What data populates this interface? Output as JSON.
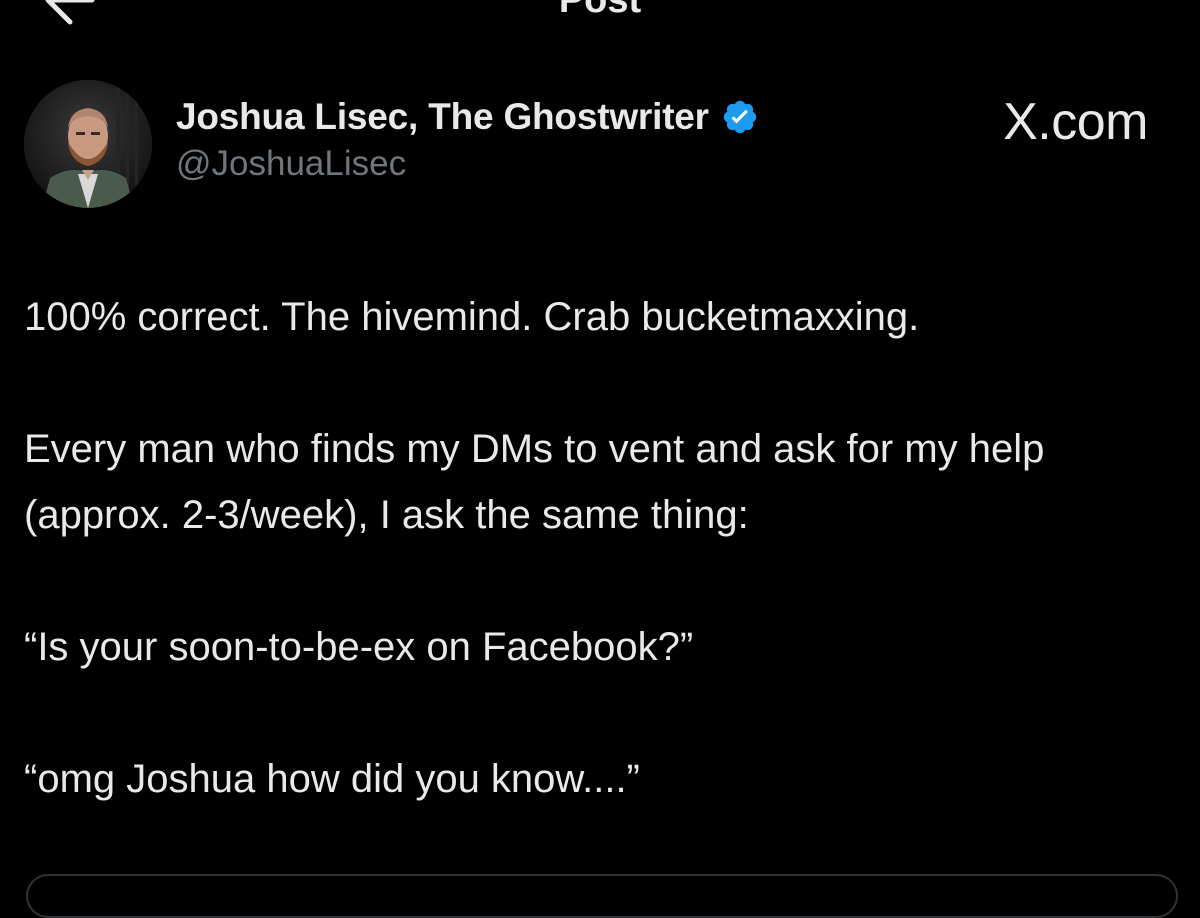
{
  "header": {
    "title": "Post",
    "back_icon": "back-arrow-icon",
    "more_icon": "more-options-icon"
  },
  "author": {
    "display_name": "Joshua Lisec, The Ghostwriter",
    "handle": "@JoshuaLisec",
    "verified": true,
    "verified_color": "#1d9bf0",
    "avatar_icon": "profile-photo"
  },
  "watermark": "X.com",
  "tweet": {
    "paragraphs": [
      "100% correct. The hivemind. Crab bucketmaxxing.",
      "Every man who finds my DMs to vent and ask for my help (approx. 2-3/week), I ask the same thing:",
      "“Is your soon-to-be-ex on Facebook?”",
      "“omg Joshua how did you know....”"
    ]
  },
  "colors": {
    "background": "#000000",
    "text": "#e7e9ea",
    "secondary_text": "#71767b",
    "accent": "#1d9bf0",
    "border": "#2f3336"
  }
}
